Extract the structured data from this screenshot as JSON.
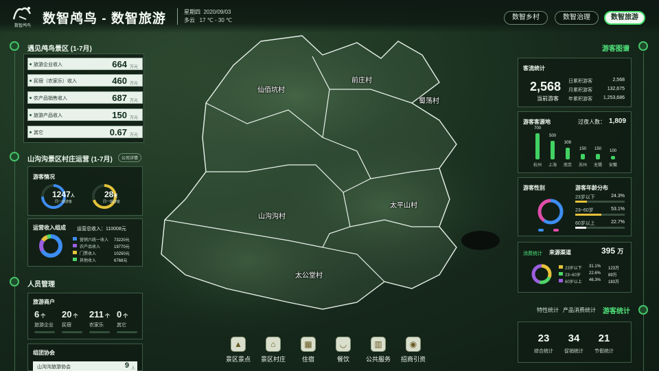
{
  "header": {
    "title": "数智鸬鸟 - 数智旅游",
    "logo_text": "数智鸬鸟",
    "weekday": "星期四",
    "date": "2020/09/03",
    "weather": "多云",
    "temp": "17 ℃ - 30 ℃",
    "nav": [
      {
        "label": "数智乡村"
      },
      {
        "label": "数智治理"
      },
      {
        "label": "数智旅游"
      }
    ]
  },
  "villages": [
    "仙佰坑村",
    "前庄村",
    "蜀荡村",
    "山沟沟村",
    "太平山村",
    "太公堂村"
  ],
  "left": {
    "sec1": {
      "title": "遇见鸬鸟景区 (1-7月)",
      "rows": [
        {
          "label": "旅游企业收入",
          "value": "664",
          "unit": "万元"
        },
        {
          "label": "民宿（农家乐）收入",
          "value": "460",
          "unit": "万元"
        },
        {
          "label": "农产品销售收入",
          "value": "687",
          "unit": "万元"
        },
        {
          "label": "旅游产品收入",
          "value": "150",
          "unit": "万元"
        },
        {
          "label": "其它",
          "value": "0.67",
          "unit": "万元"
        }
      ]
    },
    "sec2": {
      "title": "山沟沟景区村庄运营 (1-7月)",
      "badge": "公司详情",
      "visitors": {
        "title": "游客情况",
        "ring1_value": "1247",
        "ring1_unit": "人",
        "ring1_label": "同一期游客",
        "ring2_value": "28",
        "ring2_unit": "天",
        "ring2_label": "同一期游客"
      },
      "revenue": {
        "title": "运营收入组成",
        "total_label": "运营总收入：110008元",
        "items": [
          {
            "label": "营销六统一收入",
            "value": "73220元",
            "color": "#3d8df2"
          },
          {
            "label": "农产品收入",
            "value": "19770元",
            "color": "#9b5fe0"
          },
          {
            "label": "门票收入",
            "value": "10250元",
            "color": "#e6c23a"
          },
          {
            "label": "其他收入",
            "value": "6768元",
            "color": "#4fd46a"
          }
        ]
      }
    },
    "sec3": {
      "title": "人员管理",
      "tourism": {
        "title": "旅游商户",
        "items": [
          {
            "value": "6",
            "unit": "个",
            "label": "旅游企业"
          },
          {
            "value": "20",
            "unit": "个",
            "label": "民宿"
          },
          {
            "value": "211",
            "unit": "个",
            "label": "农家乐"
          },
          {
            "value": "0",
            "unit": "个",
            "label": "其它"
          }
        ]
      },
      "assoc": {
        "title": "组团协会",
        "row_label": "山沟沟旅游协会",
        "row_value": "9",
        "row_unit": "人"
      }
    }
  },
  "right": {
    "title": "游客图谱",
    "stats": {
      "title": "客流统计",
      "value": "2,568",
      "label": "当前游客",
      "rows": [
        {
          "label": "日累积游客",
          "value": "2,568"
        },
        {
          "label": "月累积游客",
          "value": "132,675"
        },
        {
          "label": "年累积游客",
          "value": "1,253,686"
        }
      ]
    },
    "source": {
      "title": "游客客源地",
      "total_label": "过夜人数：",
      "total": "1,809"
    },
    "gender": {
      "title": "游客性别"
    },
    "age": {
      "title": "游客年龄分布",
      "rows": [
        {
          "label": "23岁以下",
          "pct": "24.3%",
          "frac": 0.243,
          "color": "#e6c23a"
        },
        {
          "label": "23~60岁",
          "pct": "53.1%",
          "frac": 0.531,
          "color": "#e6c23a"
        },
        {
          "label": "60岁以上",
          "pct": "22.7%",
          "frac": 0.227,
          "color": "#f0f0f0"
        }
      ]
    },
    "channel": {
      "tab1": "消费统计",
      "title": "来源渠道",
      "total": "395",
      "unit": "万",
      "rows": [
        {
          "label": "23岁以下",
          "pct": "31.1%",
          "amt": "123万",
          "color": "#e6c23a"
        },
        {
          "label": "23~60岁",
          "pct": "22.6%",
          "amt": "89万",
          "color": "#4fd46a"
        },
        {
          "label": "60岁以上",
          "pct": "46.3%",
          "amt": "183万",
          "color": "#9b5fe0"
        }
      ]
    },
    "tabs": [
      {
        "label": "特性统计"
      },
      {
        "label": "产品消费统计"
      },
      {
        "label": "游客统计"
      }
    ],
    "summary": [
      {
        "value": "23",
        "label": "综合统计"
      },
      {
        "value": "34",
        "label": "促销统计"
      },
      {
        "value": "21",
        "label": "节假统计"
      }
    ]
  },
  "bottom_nav": [
    {
      "label": "景区景点",
      "icon": "mountain-icon"
    },
    {
      "label": "景区村庄",
      "icon": "temple-icon"
    },
    {
      "label": "住宿",
      "icon": "hotel-icon"
    },
    {
      "label": "餐饮",
      "icon": "bowl-icon"
    },
    {
      "label": "公共服务",
      "icon": "building-icon"
    },
    {
      "label": "招商引资",
      "icon": "coin-icon"
    }
  ],
  "chart_data": [
    {
      "type": "bar",
      "categories": [
        "杭州",
        "上海",
        "南京",
        "苏州",
        "无锡",
        "安徽"
      ],
      "values": [
        700,
        500,
        309,
        150,
        150,
        100
      ]
    },
    {
      "type": "pie",
      "title": "游客性别",
      "values": [
        0.6,
        0.4
      ],
      "colors": [
        "#3d8df2",
        "#e04ea8"
      ]
    },
    {
      "type": "pie",
      "title": "运营收入组成",
      "values": [
        73220,
        19770,
        10250,
        6768
      ],
      "colors": [
        "#3d8df2",
        "#9b5fe0",
        "#e6c23a",
        "#4fd46a"
      ]
    },
    {
      "type": "pie",
      "title": "来源渠道",
      "values": [
        31.1,
        22.6,
        46.3
      ],
      "colors": [
        "#e6c23a",
        "#4fd46a",
        "#9b5fe0"
      ]
    }
  ]
}
